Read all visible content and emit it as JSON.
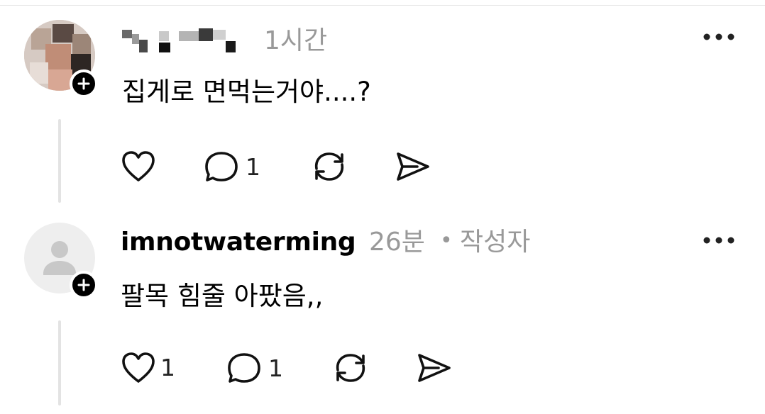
{
  "comments": [
    {
      "author_name": "",
      "time": "1시간",
      "text": "집게로 면먹는거야....?",
      "actions": {
        "like_count": "",
        "reply_count": "1"
      }
    },
    {
      "author_name": "imnotwaterming",
      "time": "26분",
      "separator": "•",
      "author_tag": "작성자",
      "text": "팔목 힘줄 아팠음,,",
      "actions": {
        "like_count": "1",
        "reply_count": "1"
      }
    }
  ],
  "icons": [
    "more-icon",
    "heart-icon",
    "comment-icon",
    "repost-icon",
    "share-icon",
    "plus-icon",
    "default-avatar-icon"
  ],
  "colors": {
    "meta_gray": "#999999",
    "thread_line": "#e3e3e3",
    "badge": "#000000"
  }
}
